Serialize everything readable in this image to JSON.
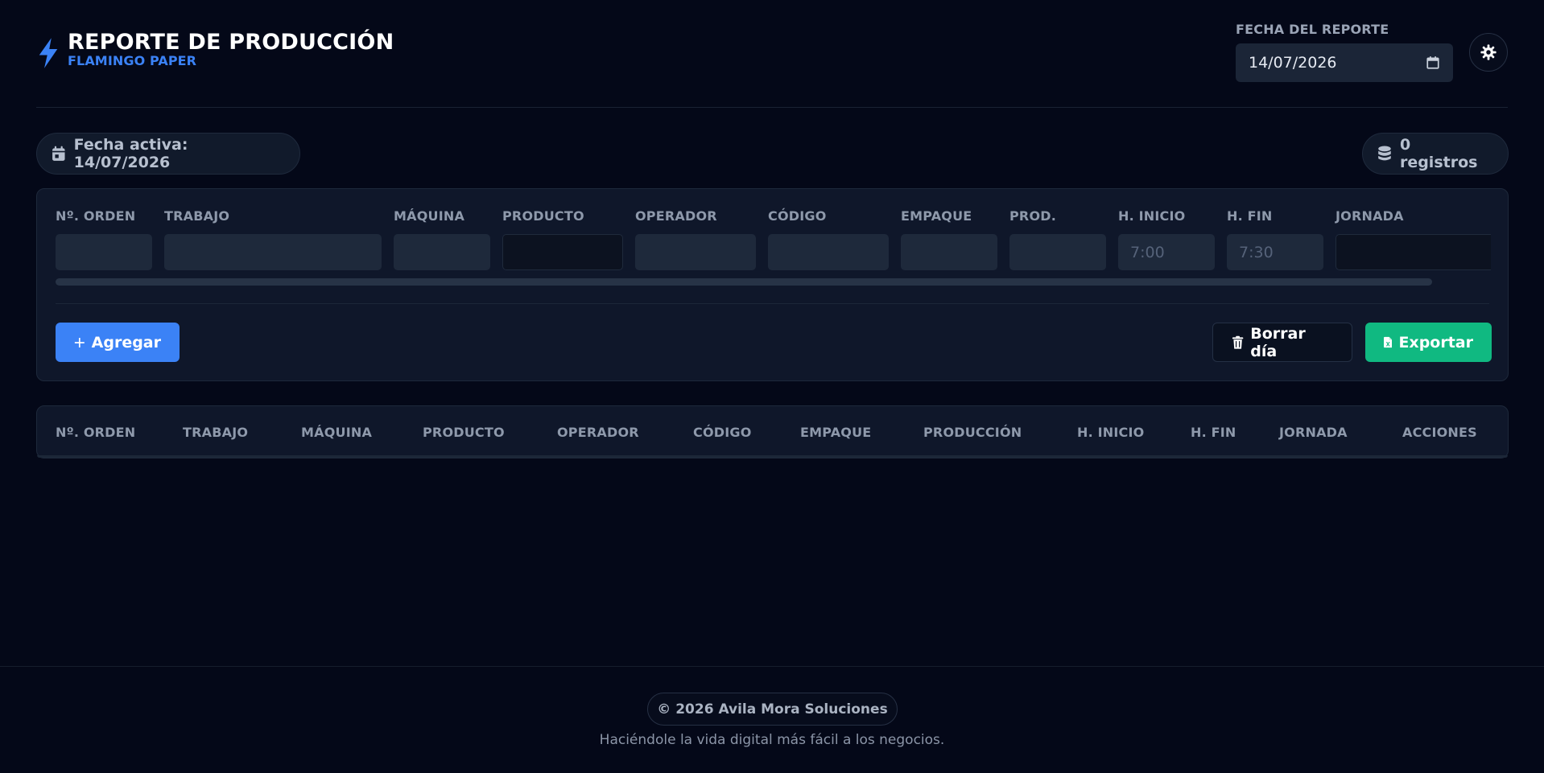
{
  "header": {
    "title": "REPORTE DE PRODUCCIÓN",
    "subtitle": "FLAMINGO PAPER",
    "date_label": "FECHA DEL REPORTE",
    "date_value": "14/07/2026"
  },
  "status": {
    "active_date": "Fecha activa: 14/07/2026",
    "records": "0 registros"
  },
  "form": {
    "fields": [
      {
        "label": "Nº. ORDEN",
        "value": ""
      },
      {
        "label": "TRABAJO",
        "value": ""
      },
      {
        "label": "MÁQUINA",
        "value": ""
      },
      {
        "label": "PRODUCTO",
        "value": ""
      },
      {
        "label": "OPERADOR",
        "value": ""
      },
      {
        "label": "CÓDIGO",
        "value": ""
      },
      {
        "label": "EMPAQUE",
        "value": ""
      },
      {
        "label": "PROD.",
        "value": ""
      },
      {
        "label": "H. INICIO",
        "placeholder": "7:00"
      },
      {
        "label": "H. FIN",
        "placeholder": "7:30"
      },
      {
        "label": "JORNADA",
        "value": ""
      }
    ],
    "add_label": "Agregar",
    "clear_label": "Borrar día",
    "export_label": "Exportar"
  },
  "table": {
    "columns": [
      "Nº. ORDEN",
      "TRABAJO",
      "MÁQUINA",
      "PRODUCTO",
      "OPERADOR",
      "CÓDIGO",
      "EMPAQUE",
      "PRODUCCIÓN",
      "H. INICIO",
      "H. FIN",
      "JORNADA",
      "ACCIONES"
    ],
    "rows": []
  },
  "footer": {
    "copyright": "© 2026 Avila Mora Soluciones",
    "tagline": "Haciéndole la vida digital más fácil a los negocios."
  },
  "colors": {
    "background": "#040818",
    "accent": "#3b82f6",
    "success": "#10b981",
    "panel": "#0f172a"
  },
  "icons": [
    "bolt-icon",
    "calendar-icon",
    "gear-icon",
    "database-icon",
    "plus-icon",
    "trash-icon",
    "excel-icon"
  ]
}
